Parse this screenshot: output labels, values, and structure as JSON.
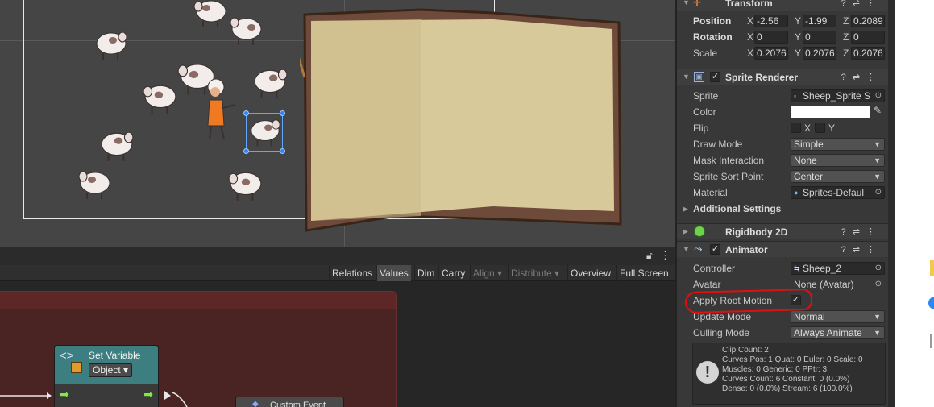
{
  "graph_toolbar": {
    "buttons": [
      "Relations",
      "Values",
      "Dim",
      "Carry",
      "Align",
      "Distribute",
      "Overview",
      "Full Screen"
    ],
    "align_arrow": "▾",
    "distribute_arrow": "▾"
  },
  "graph": {
    "set_variable_title": "Set Variable",
    "set_variable_type": "Object",
    "custom_event_title": "Custom Event"
  },
  "inspector": {
    "transform": {
      "title": "Transform",
      "position_label": "Position",
      "rotation_label": "Rotation",
      "scale_label": "Scale",
      "position": {
        "x": "-2.56",
        "y": "-1.99",
        "z": "0.2089"
      },
      "rotation": {
        "x": "0",
        "y": "0",
        "z": "0"
      },
      "scale": {
        "x": "0.2076",
        "y": "0.2076",
        "z": "0.2076"
      }
    },
    "sprite_renderer": {
      "title": "Sprite Renderer",
      "enabled": true,
      "rows": {
        "sprite_label": "Sprite",
        "sprite_value": "Sheep_Sprite S",
        "color_label": "Color",
        "flip_label": "Flip",
        "flip_x": "X",
        "flip_y": "Y",
        "draw_mode_label": "Draw Mode",
        "draw_mode_value": "Simple",
        "mask_label": "Mask Interaction",
        "mask_value": "None",
        "sort_label": "Sprite Sort Point",
        "sort_value": "Center",
        "material_label": "Material",
        "material_value": "Sprites-Defaul"
      },
      "additional_settings": "Additional Settings"
    },
    "rigidbody": {
      "title": "Rigidbody 2D"
    },
    "animator": {
      "title": "Animator",
      "enabled": true,
      "controller_label": "Controller",
      "controller_value": "Sheep_2",
      "avatar_label": "Avatar",
      "avatar_value": "None (Avatar)",
      "apply_root_motion_label": "Apply Root Motion",
      "apply_root_motion": true,
      "update_mode_label": "Update Mode",
      "update_mode_value": "Normal",
      "culling_mode_label": "Culling Mode",
      "culling_mode_value": "Always Animate",
      "info": "Clip Count: 2\nCurves Pos: 1 Quat: 0 Euler: 0 Scale: 0\nMuscles: 0 Generic: 0 PPtr: 3\nCurves Count: 6 Constant: 0 (0.0%)\nDense: 0 (0.0%) Stream: 6 (100.0%)"
    }
  },
  "colors": {
    "accent": "#2f86f5",
    "annotation": "#e01010",
    "node_header": "#3d7f80",
    "group": "#4a2323"
  }
}
